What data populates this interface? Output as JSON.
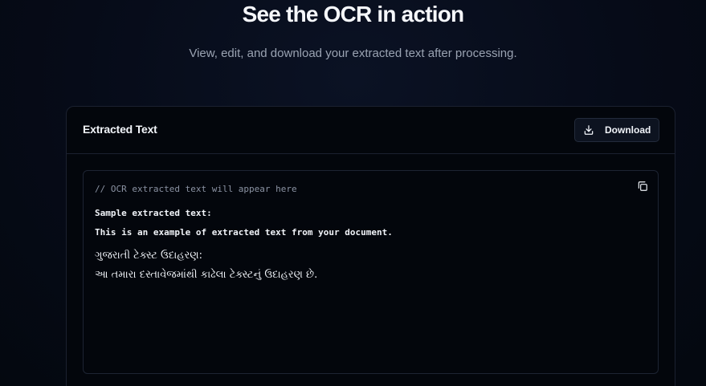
{
  "hero": {
    "title": "See the OCR in action",
    "subtitle": "View, edit, and download your extracted text after processing."
  },
  "card": {
    "title": "Extracted Text",
    "download_label": "Download",
    "download_icon": "download-icon",
    "copy_icon": "copy-icon"
  },
  "output": {
    "comment": "// OCR extracted text will appear here",
    "lines": [
      "Sample extracted text:",
      "This is an example of extracted text from your document.",
      "ગુજરાતી ટેક્સ્ટ ઉદાહરણ:",
      "આ તમારા દસ્તાવેજમાંથી કાઢેલા ટેક્સ્ટનું ઉદાહરણ છે."
    ]
  },
  "colors": {
    "background": "#050a16",
    "card": "#03060c",
    "border": "#1b2130",
    "text": "#f1f4f9",
    "muted": "#9aa3b2"
  }
}
